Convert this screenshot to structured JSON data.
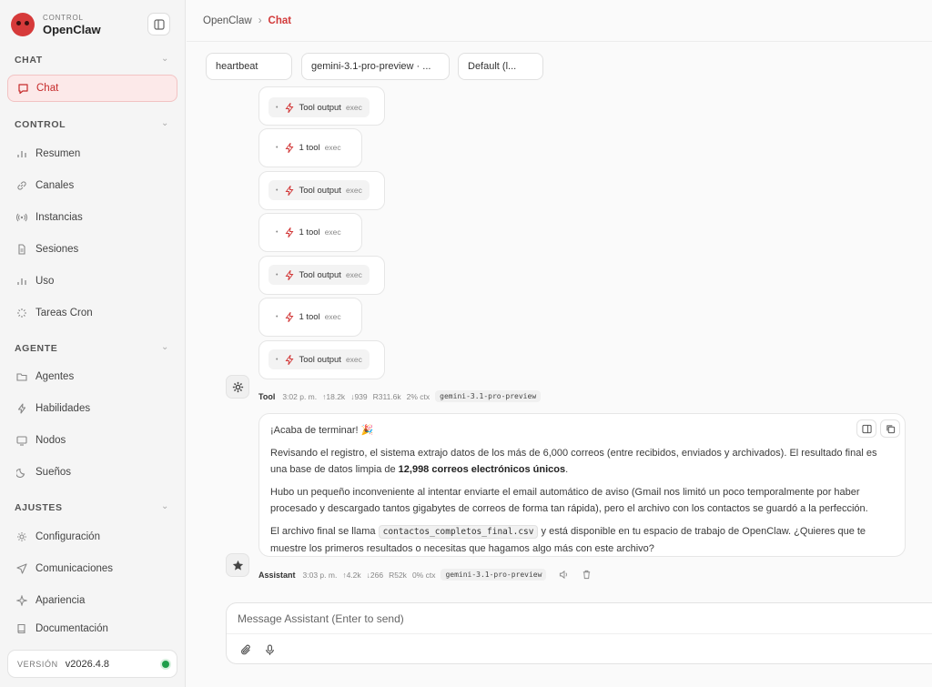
{
  "brand": {
    "small": "CONTROL",
    "name": "OpenClaw"
  },
  "sidebar": {
    "sections": [
      {
        "title": "CHAT",
        "items": [
          {
            "label": "Chat",
            "icon": "chat-bubble-icon",
            "active": true
          }
        ]
      },
      {
        "title": "CONTROL",
        "items": [
          {
            "label": "Resumen",
            "icon": "bar-chart-icon"
          },
          {
            "label": "Canales",
            "icon": "link-icon"
          },
          {
            "label": "Instancias",
            "icon": "broadcast-icon"
          },
          {
            "label": "Sesiones",
            "icon": "document-icon"
          },
          {
            "label": "Uso",
            "icon": "bar-chart-icon"
          },
          {
            "label": "Tareas Cron",
            "icon": "spinner-icon"
          }
        ]
      },
      {
        "title": "AGENTE",
        "items": [
          {
            "label": "Agentes",
            "icon": "folder-icon"
          },
          {
            "label": "Habilidades",
            "icon": "bolt-icon"
          },
          {
            "label": "Nodos",
            "icon": "monitor-icon"
          },
          {
            "label": "Sueños",
            "icon": "moon-icon"
          }
        ]
      },
      {
        "title": "AJUSTES",
        "items": [
          {
            "label": "Configuración",
            "icon": "gear-icon"
          },
          {
            "label": "Comunicaciones",
            "icon": "send-icon"
          },
          {
            "label": "Apariencia",
            "icon": "sparkle-icon"
          }
        ]
      }
    ],
    "docs": {
      "label": "Documentación",
      "icon": "book-icon"
    },
    "version": {
      "label": "VERSIÓN",
      "value": "v2026.4.8",
      "status_color": "#1e9e4a"
    }
  },
  "header": {
    "root": "OpenClaw",
    "separator": "›",
    "current": "Chat"
  },
  "selectors": {
    "session": "heartbeat",
    "model": "gemini-3.1-pro-preview · ...",
    "thinking": "Default (l..."
  },
  "tool_cards": [
    {
      "label": "Tool output",
      "tag": "exec"
    },
    {
      "label": "1 tool",
      "tag": "exec"
    },
    {
      "label": "Tool output",
      "tag": "exec"
    },
    {
      "label": "1 tool",
      "tag": "exec"
    },
    {
      "label": "Tool output",
      "tag": "exec"
    },
    {
      "label": "1 tool",
      "tag": "exec"
    },
    {
      "label": "Tool output",
      "tag": "exec"
    }
  ],
  "tool_meta": {
    "who": "Tool",
    "time": "3:02 p. m.",
    "up": "↑18.2k",
    "down": "↓939",
    "r": "R311.6k",
    "ctx": "2% ctx",
    "model": "gemini-3.1-pro-preview"
  },
  "assistant_message": {
    "p1": "¡Acaba de terminar! 🎉",
    "p2_a": "Revisando el registro, el sistema extrajo datos de los más de 6,000 correos (entre recibidos, enviados y archivados). El resultado final es una base de datos limpia de ",
    "p2_b": "12,998 correos electrónicos únicos",
    "p2_c": ".",
    "p3": "Hubo un pequeño inconveniente al intentar enviarte el email automático de aviso (Gmail nos limitó un poco temporalmente por haber procesado y descargado tantos gigabytes de correos de forma tan rápida), pero el archivo con los contactos se guardó a la perfección.",
    "p4_a": "El archivo final se llama ",
    "p4_code": "contactos_completos_final.csv",
    "p4_b": " y está disponible en tu espacio de trabajo de OpenClaw. ¿Quieres que te muestre los primeros resultados o necesitas que hagamos algo más con este archivo?"
  },
  "assistant_meta": {
    "who": "Assistant",
    "time": "3:03 p. m.",
    "up": "↑4.2k",
    "down": "↓266",
    "r": "R52k",
    "ctx": "0% ctx",
    "model": "gemini-3.1-pro-preview"
  },
  "composer": {
    "placeholder": "Message Assistant (Enter to send)"
  },
  "colors": {
    "accent": "#d23a3a",
    "active_bg": "#fce9e9"
  }
}
